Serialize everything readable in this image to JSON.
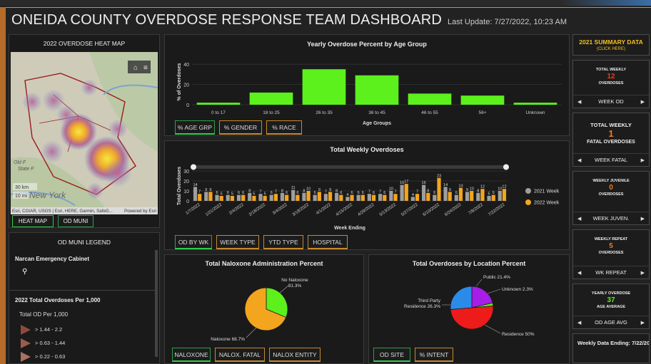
{
  "header": {
    "title": "ONEIDA COUNTY OVERDOSE RESPONSE TEAM DASHBOARD",
    "last_update": "Last Update: 7/27/2022, 10:23 AM"
  },
  "heatmap": {
    "title": "2022 OVERDOSE HEAT MAP",
    "attribution": "Esri, CGIAR, USGS | Esri, HERE, Garmin, SafeG...",
    "powered": "Powered by Esri",
    "scale_km": "30 km",
    "scale_mi": "10 mi",
    "label_state": "New York",
    "label_old": "Old F",
    "label_state_park": "State F",
    "home_icon": "home-icon",
    "list_icon": "list-icon"
  },
  "map_buttons": {
    "heat_map": "HEAT MAP",
    "od_muni": "OD MUNI"
  },
  "legend": {
    "title": "OD MUNI LEGEND",
    "narcan": "Narcan Emergency Cabinet",
    "per1000_title": "2022 Total Overdoses Per 1,000",
    "sub": "Total OD Per 1,000",
    "ranges": [
      "> 1.44 - 2.2",
      "> 0.63 - 1.44",
      "> 0.22 - 0.63"
    ],
    "range_colors": [
      "#8e4a3c",
      "#9b5a4b",
      "#a9705f"
    ]
  },
  "age_chart": {
    "title": "Yearly Overdose Percent by Age Group",
    "xlabel": "Age Groups",
    "ylabel": "% of Overdoses",
    "ticks": [
      "0",
      "20",
      "40"
    ],
    "tabs": [
      "% AGE GRP",
      "% GENDER",
      "% RACE"
    ]
  },
  "weekly_chart": {
    "title": "Total Weekly Overdoses",
    "xlabel": "Week Ending",
    "ylabel": "Total Overdoses",
    "ticks": [
      "0",
      "10",
      "20",
      "30"
    ],
    "legend": [
      "2021 Week",
      "2022 Week"
    ],
    "tabs": [
      "OD BY WK",
      "WEEK TYPE",
      "YTD TYPE",
      "HOSPITAL"
    ]
  },
  "naloxone_chart": {
    "title": "Total Naloxone Administration Percent",
    "labels": [
      "No Naloxone 31.3%",
      "Naloxone 68.7%"
    ],
    "tabs": [
      "NALOXONE",
      "NALOX. FATAL",
      "NALOX ENTITY"
    ]
  },
  "location_chart": {
    "title": "Total Overdoses by Location Percent",
    "labels": [
      "Public 21.4%",
      "Unknown 2.3%",
      "Third Party Residence 26.3%",
      "Residence 50%"
    ],
    "tabs": [
      "OD SITE",
      "% INTENT"
    ]
  },
  "summary": {
    "header": "2021 SUMMARY DATA",
    "header_sub": "(CLICK HERE)",
    "cards": [
      {
        "label_top": "TOTAL WEEKLY",
        "value": "12",
        "label_bottom": "OVERDOSES",
        "select": "WEEK OD"
      },
      {
        "label_top": "TOTAL WEEKLY",
        "value": "1",
        "label_bottom": "FATAL OVERDOSES",
        "select": "WEEK FATAL"
      },
      {
        "label_top": "WEEKLY JUVENILE",
        "value": "0",
        "label_bottom": "OVERDOSES",
        "select": "WEEK JUVEN."
      },
      {
        "label_top": "WEEKLY REPEAT",
        "value": "5",
        "label_bottom": "OVERDOSES",
        "select": "WK REPEAT"
      },
      {
        "label_top": "YEARLY OVERDOSE",
        "value": "37",
        "label_bottom": "AGE AVERAGE",
        "select": "OD AGE AVG"
      }
    ],
    "footer": "Weekly Data Ending: 7/22/2022"
  },
  "chart_data": [
    {
      "type": "bar",
      "title": "Yearly Overdose Percent by Age Group",
      "xlabel": "Age Groups",
      "ylabel": "% of Overdoses",
      "categories": [
        "0 to 17",
        "18 to 25",
        "26 to 35",
        "36 to 45",
        "46 to 55",
        "56+",
        "Unknown"
      ],
      "values": [
        2,
        12,
        35,
        29,
        11,
        9,
        2
      ],
      "ylim": [
        0,
        45
      ],
      "color": "#5cf01c"
    },
    {
      "type": "bar",
      "title": "Total Weekly Overdoses",
      "xlabel": "Week Ending",
      "ylabel": "Total Overdoses",
      "categories": [
        "1/7/2022",
        "1/14/2022",
        "1/21/2022",
        "1/28/2022",
        "2/4/2022",
        "2/11/2022",
        "2/18/2022",
        "2/25/2022",
        "3/4/2022",
        "3/11/2022",
        "3/18/2022",
        "3/25/2022",
        "4/1/2022",
        "4/8/2022",
        "4/15/2022",
        "4/22/2022",
        "4/29/2022",
        "5/6/2022",
        "5/13/2022",
        "5/20/2022",
        "5/27/2022",
        "6/3/2022",
        "6/10/2022",
        "6/17/2022",
        "6/24/2022",
        "7/1/2022",
        "7/8/2022",
        "7/15/2022",
        "7/22/2022"
      ],
      "tick_labels": [
        "1/7/2022",
        "1/21/2022",
        "2/4/2022",
        "2/18/2022",
        "3/4/2022",
        "3/18/2022",
        "4/1/2022",
        "4/15/2022",
        "4/29/2022",
        "5/13/2022",
        "5/27/2022",
        "6/10/2022",
        "6/24/2022",
        "7/8/2022",
        "7/22/2022"
      ],
      "series": [
        {
          "name": "2021 Week",
          "color": "#9e9e9e",
          "values": [
            14,
            9,
            6,
            6,
            6,
            8,
            7,
            6,
            8,
            11,
            8,
            6,
            7,
            8,
            4,
            6,
            7,
            7,
            10,
            16,
            4,
            16,
            6,
            14,
            6,
            9,
            8,
            5,
            10
          ]
        },
        {
          "name": "2022 Week",
          "color": "#f3a51e",
          "values": [
            7,
            9,
            5,
            5,
            6,
            5,
            5,
            7,
            6,
            6,
            10,
            9,
            9,
            6,
            6,
            6,
            6,
            6,
            7,
            17,
            7,
            8,
            23,
            9,
            13,
            10,
            12,
            6,
            12
          ]
        }
      ],
      "ylim": [
        0,
        30
      ]
    },
    {
      "type": "pie",
      "title": "Total Naloxone Administration Percent",
      "labels": [
        "No Naloxone",
        "Naloxone"
      ],
      "values": [
        31.3,
        68.7
      ],
      "colors": [
        "#5cf01c",
        "#f3a51e"
      ]
    },
    {
      "type": "pie",
      "title": "Total Overdoses by Location Percent",
      "labels": [
        "Public",
        "Unknown",
        "Residence",
        "Third Party Residence"
      ],
      "values": [
        21.4,
        2.3,
        50,
        26.3
      ],
      "colors": [
        "#a61ee8",
        "#5cf01c",
        "#ee1b1b",
        "#2b8be8"
      ]
    }
  ]
}
